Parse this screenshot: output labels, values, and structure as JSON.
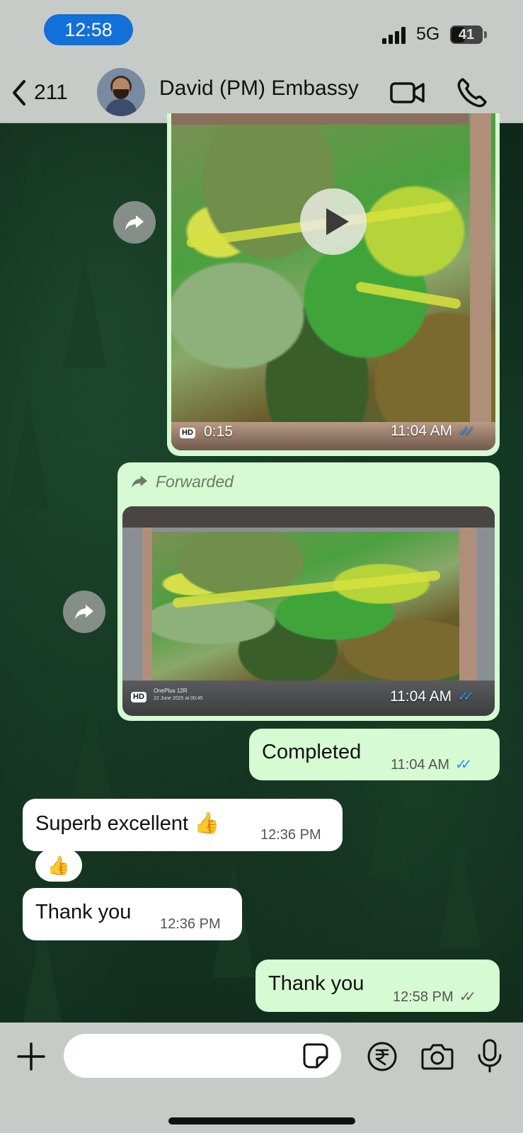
{
  "status_bar": {
    "time": "12:58",
    "network": "5G",
    "battery": "41"
  },
  "header": {
    "back_count": "211",
    "contact_name": "David (PM) Embassy"
  },
  "messages": {
    "video_message": {
      "duration": "0:15",
      "time": "11:04 AM",
      "status": "read"
    },
    "forwarded_message": {
      "forwarded_label": "Forwarded",
      "watermark_device": "OnePlus 12R",
      "watermark_date": "22 June 2025 at 00:45",
      "time": "11:04 AM",
      "status": "read"
    },
    "completed_message": {
      "text": "Completed",
      "time": "11:04 AM",
      "status": "read"
    },
    "superb_message": {
      "text": "Superb excellent 👍",
      "time": "12:36 PM",
      "reaction": "👍"
    },
    "thank_you_in": {
      "text": "Thank you",
      "time": "12:36 PM"
    },
    "thank_you_out": {
      "text": "Thank you",
      "time": "12:58 PM",
      "status": "delivered"
    }
  },
  "labels": {
    "hd": "HD",
    "ticks": "✓✓"
  },
  "colors": {
    "time_pill": "#1270d8",
    "outgoing_bubble": "#d6fad1",
    "incoming_bubble": "#ffffff",
    "read_ticks": "#2f8cf0",
    "bar_background": "#c7cbc8"
  },
  "icons": {
    "back": "chevron-left-icon",
    "video_call": "video-camera-icon",
    "voice_call": "phone-icon",
    "forward": "forward-arrow-icon",
    "attach": "plus-icon",
    "sticker": "sticker-icon",
    "payment": "rupee-icon",
    "camera": "camera-icon",
    "mic": "microphone-icon"
  }
}
